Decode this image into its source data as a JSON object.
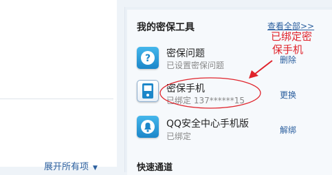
{
  "left": {
    "expand_all_label": "展开所有项",
    "expand_caret": "▼"
  },
  "panel": {
    "title": "我的密保工具",
    "view_all_label": "查看全部>>",
    "quick_channel_title": "快速通道"
  },
  "tools": [
    {
      "name": "密保问题",
      "status": "已设置密保问题",
      "action": "删除",
      "icon": "question-icon"
    },
    {
      "name": "密保手机",
      "status": "已绑定 137******15",
      "action": "更换",
      "icon": "phone-icon"
    },
    {
      "name": "QQ安全中心手机版",
      "status": "已绑定",
      "action": "解绑",
      "icon": "bell-shield-icon"
    }
  ],
  "annotation": {
    "line1": "已绑定密",
    "line2": "保手机",
    "color": "#e0232b"
  },
  "colors": {
    "link": "#2b5f9e",
    "icon_blue": "#1b86c9"
  }
}
